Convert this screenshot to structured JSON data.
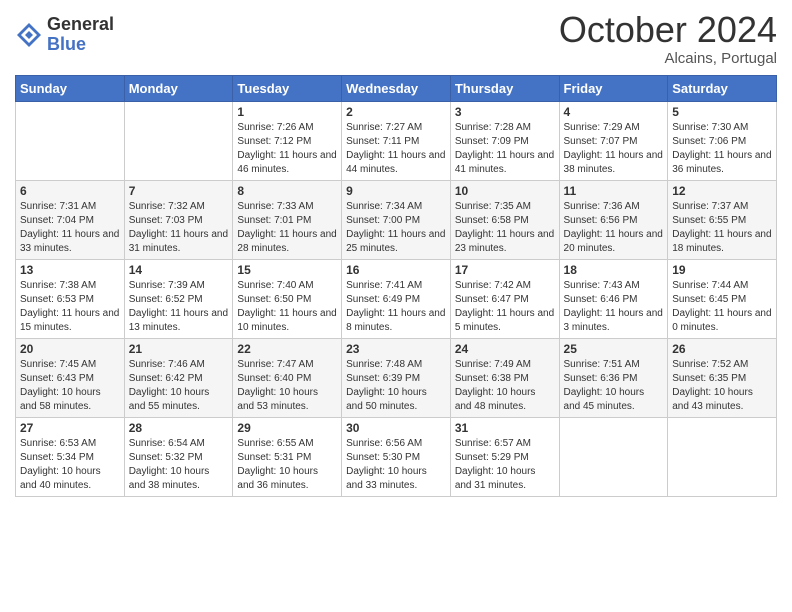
{
  "header": {
    "logo_general": "General",
    "logo_blue": "Blue",
    "month_title": "October 2024",
    "subtitle": "Alcains, Portugal"
  },
  "days_of_week": [
    "Sunday",
    "Monday",
    "Tuesday",
    "Wednesday",
    "Thursday",
    "Friday",
    "Saturday"
  ],
  "weeks": [
    [
      {
        "day": "",
        "info": ""
      },
      {
        "day": "",
        "info": ""
      },
      {
        "day": "1",
        "info": "Sunrise: 7:26 AM\nSunset: 7:12 PM\nDaylight: 11 hours and 46 minutes."
      },
      {
        "day": "2",
        "info": "Sunrise: 7:27 AM\nSunset: 7:11 PM\nDaylight: 11 hours and 44 minutes."
      },
      {
        "day": "3",
        "info": "Sunrise: 7:28 AM\nSunset: 7:09 PM\nDaylight: 11 hours and 41 minutes."
      },
      {
        "day": "4",
        "info": "Sunrise: 7:29 AM\nSunset: 7:07 PM\nDaylight: 11 hours and 38 minutes."
      },
      {
        "day": "5",
        "info": "Sunrise: 7:30 AM\nSunset: 7:06 PM\nDaylight: 11 hours and 36 minutes."
      }
    ],
    [
      {
        "day": "6",
        "info": "Sunrise: 7:31 AM\nSunset: 7:04 PM\nDaylight: 11 hours and 33 minutes."
      },
      {
        "day": "7",
        "info": "Sunrise: 7:32 AM\nSunset: 7:03 PM\nDaylight: 11 hours and 31 minutes."
      },
      {
        "day": "8",
        "info": "Sunrise: 7:33 AM\nSunset: 7:01 PM\nDaylight: 11 hours and 28 minutes."
      },
      {
        "day": "9",
        "info": "Sunrise: 7:34 AM\nSunset: 7:00 PM\nDaylight: 11 hours and 25 minutes."
      },
      {
        "day": "10",
        "info": "Sunrise: 7:35 AM\nSunset: 6:58 PM\nDaylight: 11 hours and 23 minutes."
      },
      {
        "day": "11",
        "info": "Sunrise: 7:36 AM\nSunset: 6:56 PM\nDaylight: 11 hours and 20 minutes."
      },
      {
        "day": "12",
        "info": "Sunrise: 7:37 AM\nSunset: 6:55 PM\nDaylight: 11 hours and 18 minutes."
      }
    ],
    [
      {
        "day": "13",
        "info": "Sunrise: 7:38 AM\nSunset: 6:53 PM\nDaylight: 11 hours and 15 minutes."
      },
      {
        "day": "14",
        "info": "Sunrise: 7:39 AM\nSunset: 6:52 PM\nDaylight: 11 hours and 13 minutes."
      },
      {
        "day": "15",
        "info": "Sunrise: 7:40 AM\nSunset: 6:50 PM\nDaylight: 11 hours and 10 minutes."
      },
      {
        "day": "16",
        "info": "Sunrise: 7:41 AM\nSunset: 6:49 PM\nDaylight: 11 hours and 8 minutes."
      },
      {
        "day": "17",
        "info": "Sunrise: 7:42 AM\nSunset: 6:47 PM\nDaylight: 11 hours and 5 minutes."
      },
      {
        "day": "18",
        "info": "Sunrise: 7:43 AM\nSunset: 6:46 PM\nDaylight: 11 hours and 3 minutes."
      },
      {
        "day": "19",
        "info": "Sunrise: 7:44 AM\nSunset: 6:45 PM\nDaylight: 11 hours and 0 minutes."
      }
    ],
    [
      {
        "day": "20",
        "info": "Sunrise: 7:45 AM\nSunset: 6:43 PM\nDaylight: 10 hours and 58 minutes."
      },
      {
        "day": "21",
        "info": "Sunrise: 7:46 AM\nSunset: 6:42 PM\nDaylight: 10 hours and 55 minutes."
      },
      {
        "day": "22",
        "info": "Sunrise: 7:47 AM\nSunset: 6:40 PM\nDaylight: 10 hours and 53 minutes."
      },
      {
        "day": "23",
        "info": "Sunrise: 7:48 AM\nSunset: 6:39 PM\nDaylight: 10 hours and 50 minutes."
      },
      {
        "day": "24",
        "info": "Sunrise: 7:49 AM\nSunset: 6:38 PM\nDaylight: 10 hours and 48 minutes."
      },
      {
        "day": "25",
        "info": "Sunrise: 7:51 AM\nSunset: 6:36 PM\nDaylight: 10 hours and 45 minutes."
      },
      {
        "day": "26",
        "info": "Sunrise: 7:52 AM\nSunset: 6:35 PM\nDaylight: 10 hours and 43 minutes."
      }
    ],
    [
      {
        "day": "27",
        "info": "Sunrise: 6:53 AM\nSunset: 5:34 PM\nDaylight: 10 hours and 40 minutes."
      },
      {
        "day": "28",
        "info": "Sunrise: 6:54 AM\nSunset: 5:32 PM\nDaylight: 10 hours and 38 minutes."
      },
      {
        "day": "29",
        "info": "Sunrise: 6:55 AM\nSunset: 5:31 PM\nDaylight: 10 hours and 36 minutes."
      },
      {
        "day": "30",
        "info": "Sunrise: 6:56 AM\nSunset: 5:30 PM\nDaylight: 10 hours and 33 minutes."
      },
      {
        "day": "31",
        "info": "Sunrise: 6:57 AM\nSunset: 5:29 PM\nDaylight: 10 hours and 31 minutes."
      },
      {
        "day": "",
        "info": ""
      },
      {
        "day": "",
        "info": ""
      }
    ]
  ]
}
